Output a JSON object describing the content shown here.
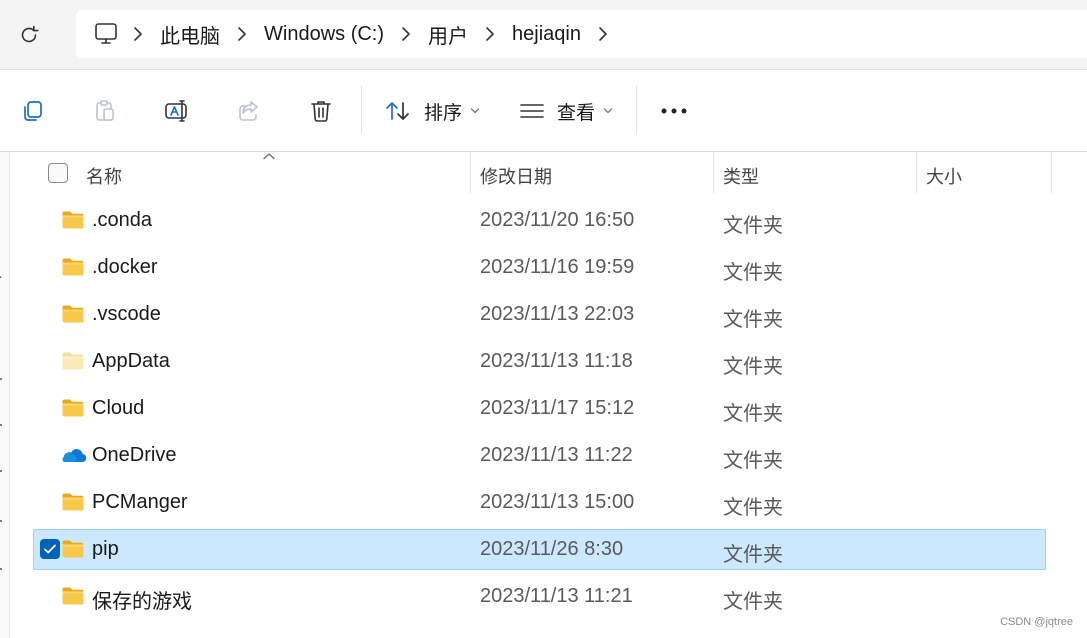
{
  "address_bar": {
    "refresh_icon": "refresh-icon",
    "computer_icon": "monitor-icon",
    "breadcrumbs": [
      "此电脑",
      "Windows (C:)",
      "用户",
      "hejiaqin"
    ]
  },
  "toolbar": {
    "buttons": [
      {
        "icon": "copy-icon"
      },
      {
        "icon": "paste-icon"
      },
      {
        "icon": "rename-icon"
      },
      {
        "icon": "share-icon"
      },
      {
        "icon": "delete-icon"
      }
    ],
    "sort_label": "排序",
    "view_label": "查看",
    "more_icon": "more-icon"
  },
  "left_pane": {
    "visible_char": "r"
  },
  "columns": {
    "name": "名称",
    "modified": "修改日期",
    "type": "类型",
    "size": "大小"
  },
  "files": [
    {
      "name": ".conda",
      "modified": "2023/11/20 16:50",
      "type": "文件夹",
      "size": "",
      "icon": "folder-icon",
      "selected": false
    },
    {
      "name": ".docker",
      "modified": "2023/11/16 19:59",
      "type": "文件夹",
      "size": "",
      "icon": "folder-icon",
      "selected": false
    },
    {
      "name": ".vscode",
      "modified": "2023/11/13 22:03",
      "type": "文件夹",
      "size": "",
      "icon": "folder-icon",
      "selected": false
    },
    {
      "name": "AppData",
      "modified": "2023/11/13 11:18",
      "type": "文件夹",
      "size": "",
      "icon": "hidden-folder-icon",
      "selected": false
    },
    {
      "name": "Cloud",
      "modified": "2023/11/17 15:12",
      "type": "文件夹",
      "size": "",
      "icon": "folder-icon",
      "selected": false
    },
    {
      "name": "OneDrive",
      "modified": "2023/11/13 11:22",
      "type": "文件夹",
      "size": "",
      "icon": "onedrive-cloud-icon",
      "selected": false
    },
    {
      "name": "PCManger",
      "modified": "2023/11/13 15:00",
      "type": "文件夹",
      "size": "",
      "icon": "folder-icon",
      "selected": false
    },
    {
      "name": "pip",
      "modified": "2023/11/26 8:30",
      "type": "文件夹",
      "size": "",
      "icon": "folder-icon",
      "selected": true
    },
    {
      "name": "保存的游戏",
      "modified": "2023/11/13 11:21",
      "type": "文件夹",
      "size": "",
      "icon": "folder-icon",
      "selected": false
    }
  ],
  "colors": {
    "accent": "#0062b8",
    "selection_bg": "#cce8ff",
    "selection_border": "#99d1ff",
    "folder": "#f7c443"
  },
  "watermark": "CSDN @jqtree"
}
